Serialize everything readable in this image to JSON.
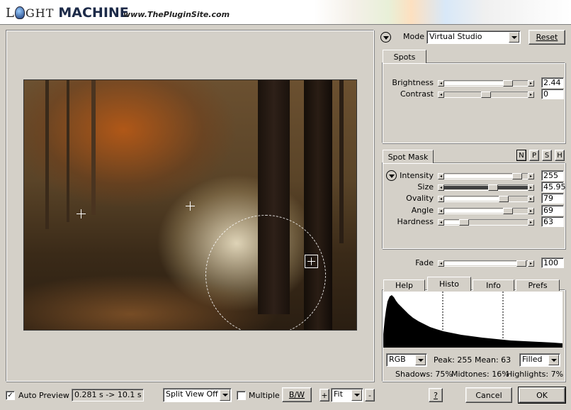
{
  "header": {
    "logo_prefix": "L",
    "logo_ight": "GHT",
    "logo_machine": "MACHINE",
    "url": "www.ThePluginSite.com"
  },
  "mode": {
    "label": "Mode",
    "value": "Virtual Studio",
    "reset": "Reset"
  },
  "spots_tab": "Spots",
  "spots": [
    {
      "label": "Brightness",
      "value": "2.44",
      "thumb": 0.8,
      "fill": 0.8
    },
    {
      "label": "Contrast",
      "value": "0",
      "thumb": 0.5,
      "fill": 0.0
    }
  ],
  "spot_mask": {
    "tab": "Spot Mask",
    "mini_buttons": [
      "N",
      "P",
      "S",
      "H"
    ],
    "sliders": [
      {
        "label": "Intensity",
        "value": "255",
        "thumb": 0.92,
        "fill": 0.92,
        "dark": false
      },
      {
        "label": "Size",
        "value": "45.95",
        "thumb": 0.6,
        "fill": 1.0,
        "dark": true
      },
      {
        "label": "Ovality",
        "value": "79",
        "thumb": 0.74,
        "fill": 0.74,
        "dark": false
      },
      {
        "label": "Angle",
        "value": "69",
        "thumb": 0.8,
        "fill": 0.8,
        "dark": false
      },
      {
        "label": "Hardness",
        "value": "63",
        "thumb": 0.2,
        "fill": 0.2,
        "dark": false
      }
    ]
  },
  "fade": {
    "label": "Fade",
    "value": "100",
    "thumb": 0.98
  },
  "info_tabs": {
    "help": "Help",
    "histo": "Histo",
    "info": "Info",
    "prefs": "Prefs"
  },
  "histogram": {
    "channel": "RGB",
    "peak": "Peak: 255",
    "mean": "Mean: 63",
    "style": "Filled",
    "shadows": "Shadows: 75%",
    "midtones": "Midtones: 16%",
    "highlights": "Highlights: 7%"
  },
  "bottom": {
    "auto_preview": "Auto Preview",
    "auto_preview_checked": true,
    "timing": "0.281 s -> 10.1 s",
    "split_view": "Split View Off",
    "multiple": "Multiple",
    "multiple_checked": false,
    "bw": "B/W",
    "plus": "+",
    "zoom": "Fit",
    "minus": "-",
    "help": "?",
    "cancel": "Cancel",
    "ok": "OK"
  }
}
